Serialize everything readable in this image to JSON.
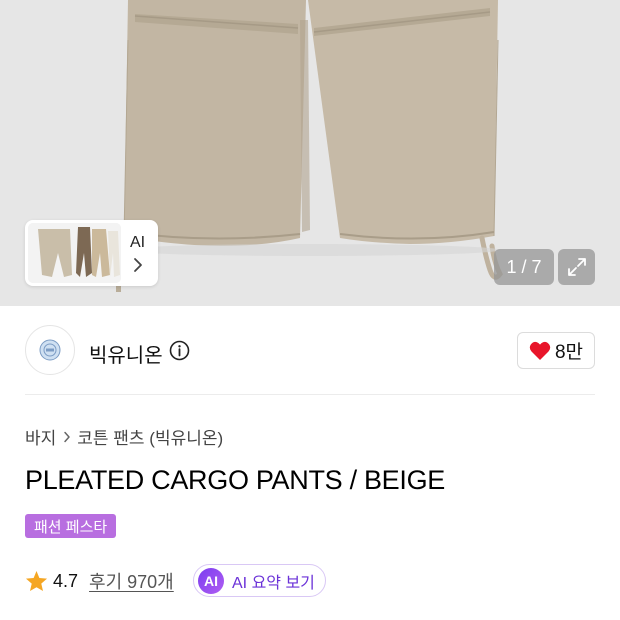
{
  "gallery": {
    "ai_label": "AI",
    "counter": "1 / 7"
  },
  "brand": {
    "name": "빅유니온",
    "like_count": "8만"
  },
  "product": {
    "breadcrumb": [
      "바지",
      "코튼 팬츠 (빅유니온)"
    ],
    "title": "PLEATED CARGO PANTS / BEIGE",
    "badge": "패션 페스타",
    "rating": "4.7",
    "review": "후기 970개",
    "ai_summary": {
      "icon_text": "AI",
      "label": "AI 요약 보기"
    }
  },
  "colors": {
    "badge": "#b86ee0",
    "heart": "#e8152a",
    "star": "#f5a623",
    "ai_accent": "#6b32d8"
  },
  "icons": [
    "chevron-right-icon",
    "expand-icon",
    "info-icon",
    "heart-icon",
    "star-icon"
  ]
}
